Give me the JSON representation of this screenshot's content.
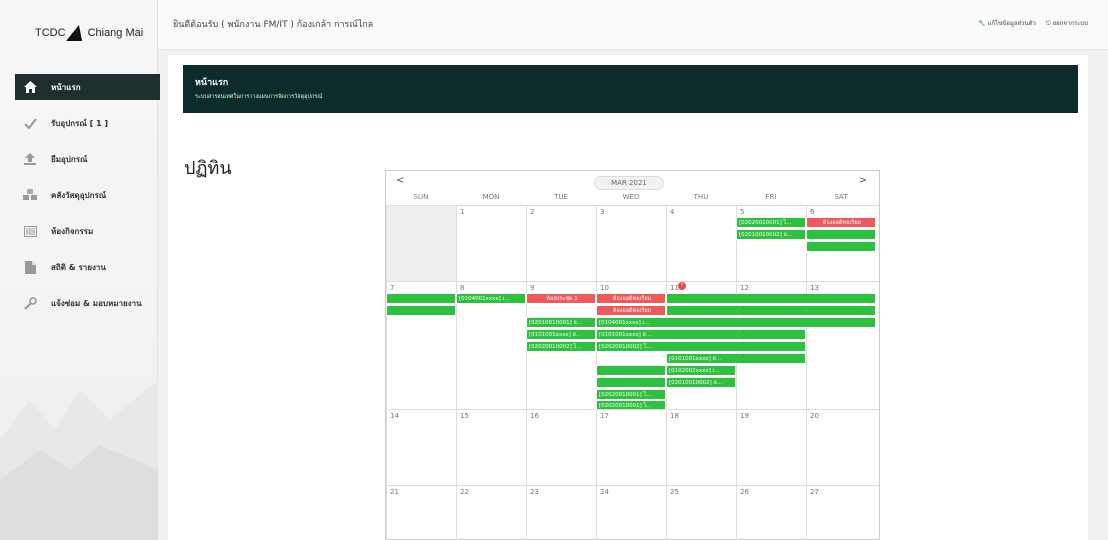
{
  "app": {
    "logo_text_left": "TCDC",
    "logo_text_right": "Chiang Mai"
  },
  "header": {
    "welcome": "ยินดีต้อนรับ ( พนักงาน FM/IT ) ก้องเกล้า การณ์ไกล",
    "edit_profile": "แก้ไขข้อมูลส่วนตัว",
    "logout": "ออกจากระบบ"
  },
  "sidebar": {
    "items": [
      {
        "label": "หน้าแรก",
        "icon": "home-icon",
        "active": true
      },
      {
        "label": "รับอุปกรณ์ [ 1 ]",
        "icon": "check-icon",
        "active": false
      },
      {
        "label": "ยืมอุปกรณ์",
        "icon": "upload-icon",
        "active": false
      },
      {
        "label": "คลังวัสดุอุปกรณ์",
        "icon": "cubes-icon",
        "active": false
      },
      {
        "label": "ห้องกิจกรรม",
        "icon": "room-icon",
        "active": false
      },
      {
        "label": "สถิติ & รายงาน",
        "icon": "report-icon",
        "active": false
      },
      {
        "label": "แจ้งซ่อม & มอบหมายงาน",
        "icon": "wrench-icon",
        "active": false
      }
    ]
  },
  "banner": {
    "title": "หน้าแรก",
    "subtitle": "ระบบสารสนเทศในการวางแผนการจัดการวัสดุอุปกรณ์"
  },
  "page": {
    "section_title": "ปฏิทิน"
  },
  "calendar": {
    "prev": "<",
    "next": ">",
    "month_label": "MAR 2021",
    "weekdays": [
      "SUN",
      "MON",
      "TUE",
      "WED",
      "THU",
      "FRI",
      "SAT"
    ],
    "weeks": [
      [
        "",
        "1",
        "2",
        "3",
        "4",
        "5",
        "6"
      ],
      [
        "7",
        "8",
        "9",
        "10",
        "11",
        "12",
        "13"
      ],
      [
        "14",
        "15",
        "16",
        "17",
        "18",
        "19",
        "20"
      ],
      [
        "21",
        "22",
        "23",
        "24",
        "25",
        "26",
        "27"
      ]
    ],
    "today_marker": "!",
    "events": {
      "w1_fri_1": "[02020010001] ไ...",
      "w1_fri_2": "[02010010002] จ...",
      "w1_sat_1": "ห้องออดิทอเรียม",
      "w2_mon_1": "[0104001xxxx] เ...",
      "w2_tue_r": "ห้องประชุม 1",
      "w2_wed_r1": "ห้องออดิทอเรียม",
      "w2_wed_r2": "ห้องออดิทอเรียม",
      "w2_tue_1": "[02010010001] จ...",
      "w2_tue_2": "[0101001xxxx] ส...",
      "w2_tue_3": "[02020010002] ไ...",
      "w2_wed_1": "[0104001xxxx] เ...",
      "w2_wed_2": "[0101001xxxx] ส...",
      "w2_wed_3": "[02020010002] ไ...",
      "w2_thu_1": "[0101001xxxx] ส...",
      "w2_thu_2": "[0102002xxxx] เ...",
      "w2_thu_3": "[02010010002] จ...",
      "w2_wed_4": "[02020010001] ไ...",
      "w2_wed_5": "[02020010001] ไ..."
    }
  }
}
